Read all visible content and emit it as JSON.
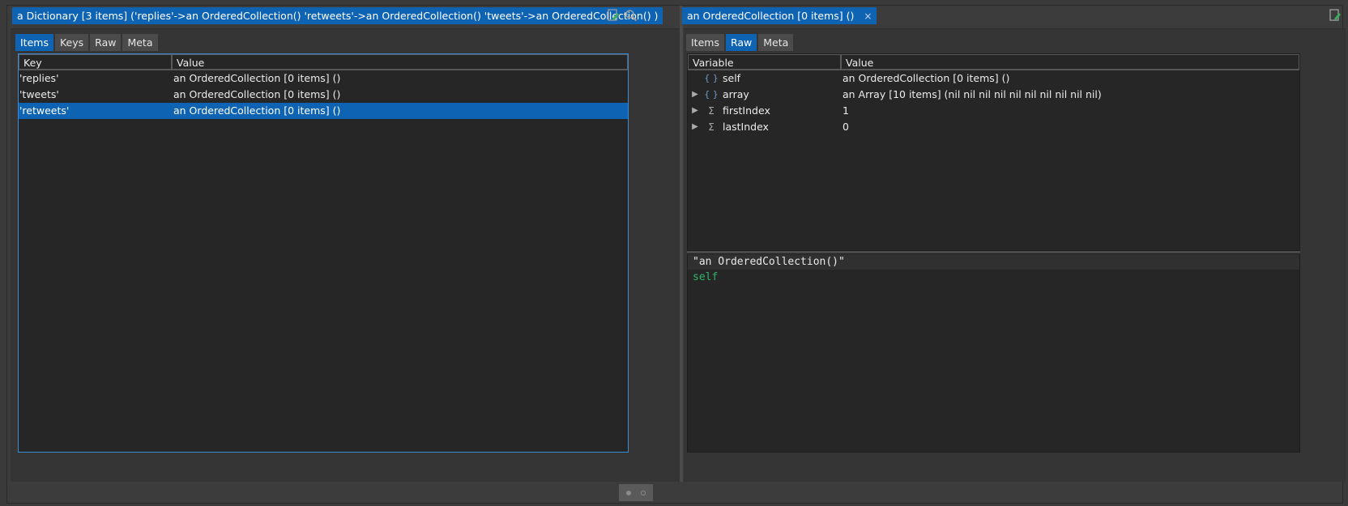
{
  "left": {
    "title": "a Dictionary [3 items] ('replies'->an OrderedCollection() 'retweets'->an OrderedCollection() 'tweets'->an OrderedCollection() )",
    "tabs": [
      "Items",
      "Keys",
      "Raw",
      "Meta"
    ],
    "active_tab": "Items",
    "columns": [
      "Key",
      "Value"
    ],
    "rows": [
      {
        "key": "'replies'",
        "value": "an OrderedCollection [0 items] ()"
      },
      {
        "key": "'tweets'",
        "value": "an OrderedCollection [0 items] ()"
      },
      {
        "key": "'retweets'",
        "value": "an OrderedCollection [0 items] ()"
      }
    ],
    "selected_row": 2,
    "icons": [
      "edit-icon",
      "search-icon"
    ]
  },
  "right": {
    "title": "an OrderedCollection [0 items] ()",
    "close_glyph": "×",
    "tabs": [
      "Items",
      "Raw",
      "Meta"
    ],
    "active_tab": "Raw",
    "columns": [
      "Variable",
      "Value"
    ],
    "rows": [
      {
        "expander": "",
        "type_glyph": "{ }",
        "variable": "self",
        "value": "an OrderedCollection [0 items] ()"
      },
      {
        "expander": "▶",
        "type_glyph": "{ }",
        "variable": "array",
        "value": "an Array [10 items] (nil nil nil nil nil nil nil nil nil nil)"
      },
      {
        "expander": "▶",
        "type_glyph": "Σ",
        "variable": "firstIndex",
        "value": "1"
      },
      {
        "expander": "▶",
        "type_glyph": "Σ",
        "variable": "lastIndex",
        "value": "0"
      }
    ],
    "code_lines": [
      "\"an OrderedCollection()\"",
      "self"
    ],
    "icons": [
      "edit-icon"
    ]
  },
  "colors": {
    "accent": "#0e63b3",
    "background": "#3a3a3a",
    "table_bg": "#262626",
    "keyword": "#2fb36c"
  }
}
